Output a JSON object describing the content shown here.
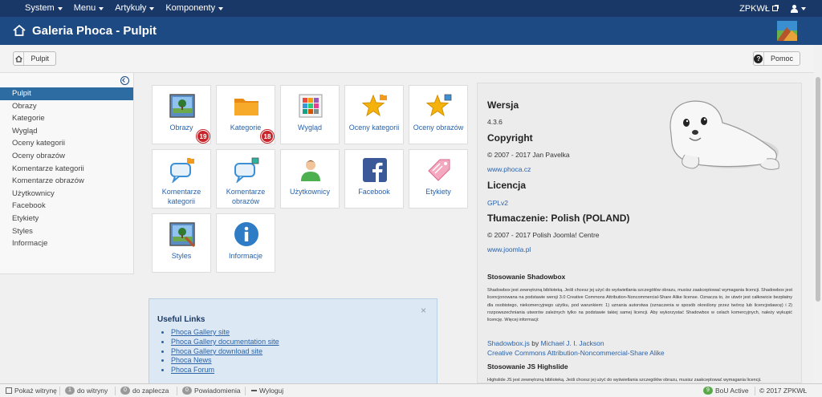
{
  "topbar": {
    "menus": [
      "System",
      "Menu",
      "Artykuły",
      "Komponenty"
    ],
    "site_label": "ZPKWŁ"
  },
  "header": {
    "title": "Galeria Phoca - Pulpit"
  },
  "toolbar": {
    "pulpit_label": "Pulpit",
    "help_label": "Pomoc"
  },
  "sidebar": {
    "items": [
      {
        "label": "Pulpit",
        "active": true
      },
      {
        "label": "Obrazy"
      },
      {
        "label": "Kategorie"
      },
      {
        "label": "Wygląd"
      },
      {
        "label": "Oceny kategorii"
      },
      {
        "label": "Oceny obrazów"
      },
      {
        "label": "Komentarze kategorii"
      },
      {
        "label": "Komentarze obrazów"
      },
      {
        "label": "Użytkownicy"
      },
      {
        "label": "Facebook"
      },
      {
        "label": "Etykiety"
      },
      {
        "label": "Styles"
      },
      {
        "label": "Informacje"
      }
    ]
  },
  "tiles": [
    {
      "label": "Obrazy",
      "icon": "image-icon",
      "badge": "19"
    },
    {
      "label": "Kategorie",
      "icon": "folder-icon",
      "badge": "18"
    },
    {
      "label": "Wygląd",
      "icon": "palette-icon"
    },
    {
      "label": "Oceny kategorii",
      "icon": "star-folder-icon"
    },
    {
      "label": "Oceny obrazów",
      "icon": "star-image-icon"
    },
    {
      "label": "Komentarze kategorii",
      "icon": "comment-folder-icon"
    },
    {
      "label": "Komentarze obrazów",
      "icon": "comment-image-icon"
    },
    {
      "label": "Użytkownicy",
      "icon": "user-icon"
    },
    {
      "label": "Facebook",
      "icon": "facebook-icon"
    },
    {
      "label": "Etykiety",
      "icon": "tag-icon"
    },
    {
      "label": "Styles",
      "icon": "styles-icon"
    },
    {
      "label": "Informacje",
      "icon": "info-icon"
    }
  ],
  "useful_links": {
    "title": "Useful Links",
    "close": "×",
    "links": [
      "Phoca Gallery site",
      "Phoca Gallery documentation site",
      "Phoca Gallery download site",
      "Phoca News",
      "Phoca Forum"
    ]
  },
  "info": {
    "version_heading": "Wersja",
    "version": "4.3.6",
    "copyright_heading": "Copyright",
    "copyright": "© 2007 - 2017 Jan Pavelka",
    "site_link": "www.phoca.cz",
    "license_heading": "Licencja",
    "license_link": "GPLv2",
    "translation_heading": "Tłumaczenie: Polish (POLAND)",
    "translation_copyright": "© 2007 - 2017 Polish Joomla! Centre",
    "translation_link": "www.joomla.pl",
    "shadowbox_heading": "Stosowanie Shadowbox",
    "shadowbox_text": "Shadowbox jest zewnętrzną biblioteką. Jeśli chcesz jej użyć do wyświetlania szczegółów obrazu, musisz zaakceptować wymagania licencji. Shadowbox jest licencjonowana na podstawie wersji 3.0 Creative Commons Attribution-Noncommercial-Share Alike license. Oznacza to, że utwór jest całkowicie bezpłatny dla osobistego, niekomercyjnego użytku, pod warunkiem: 1) uznania autorstwa (oznaczenia w sposób określony przez twórcę lub licencjodawcę) i 2) rozpowszechniania utworów zależnych tylko na podstawie takiej samej licencji. Aby wykorzystać Shadowbox w celach komercyjnych, należy wykupić licencję. Więcej informacji:",
    "shadowbox_link": "Shadowbox.js",
    "by": "by",
    "author_link": "Michael J. I. Jackson",
    "cc_link": "Creative Commons Attribution-Noncommercial-Share Alike",
    "highslide_heading": "Stosowanie JS Highslide",
    "highslide_text": "Highslide JS jest zewnętrzną biblioteką. Jeśli chcesz jej użyć do wyświetlania szczegółów obrazu, musisz zaakceptować wymagania licencji."
  },
  "statusbar": {
    "show_site": "Pokaż witrynę",
    "frontend_count": "1",
    "frontend_label": "do witryny",
    "backend_count": "0",
    "backend_label": "do zaplecza",
    "messages_count": "0",
    "messages_label": "Powiadomienia",
    "logout": "Wyloguj",
    "bou": "BoU Active",
    "copyright": "© 2017 ZPKWŁ"
  }
}
